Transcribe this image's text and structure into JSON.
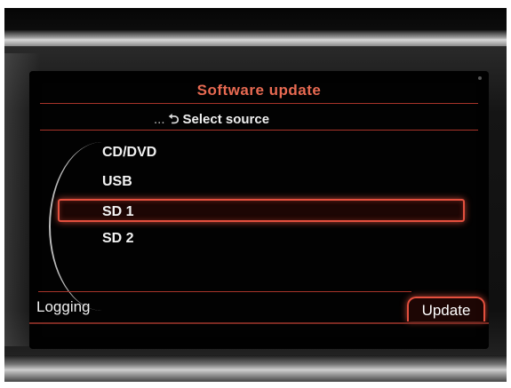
{
  "screen": {
    "title": "Software update",
    "breadcrumb": {
      "ellipsis": "...",
      "back_icon": "return-arrow-icon",
      "label": "Select source"
    },
    "sources": [
      {
        "label": "CD/DVD",
        "selected": false
      },
      {
        "label": "USB",
        "selected": false
      },
      {
        "label": "SD 1",
        "selected": true
      },
      {
        "label": "SD 2",
        "selected": false
      }
    ],
    "footer": {
      "left_label": "Logging",
      "right_label": "Update"
    }
  },
  "colors": {
    "accent": "#e4503e",
    "title": "#e86a52",
    "text": "#f2f2f2",
    "background": "#020202"
  }
}
